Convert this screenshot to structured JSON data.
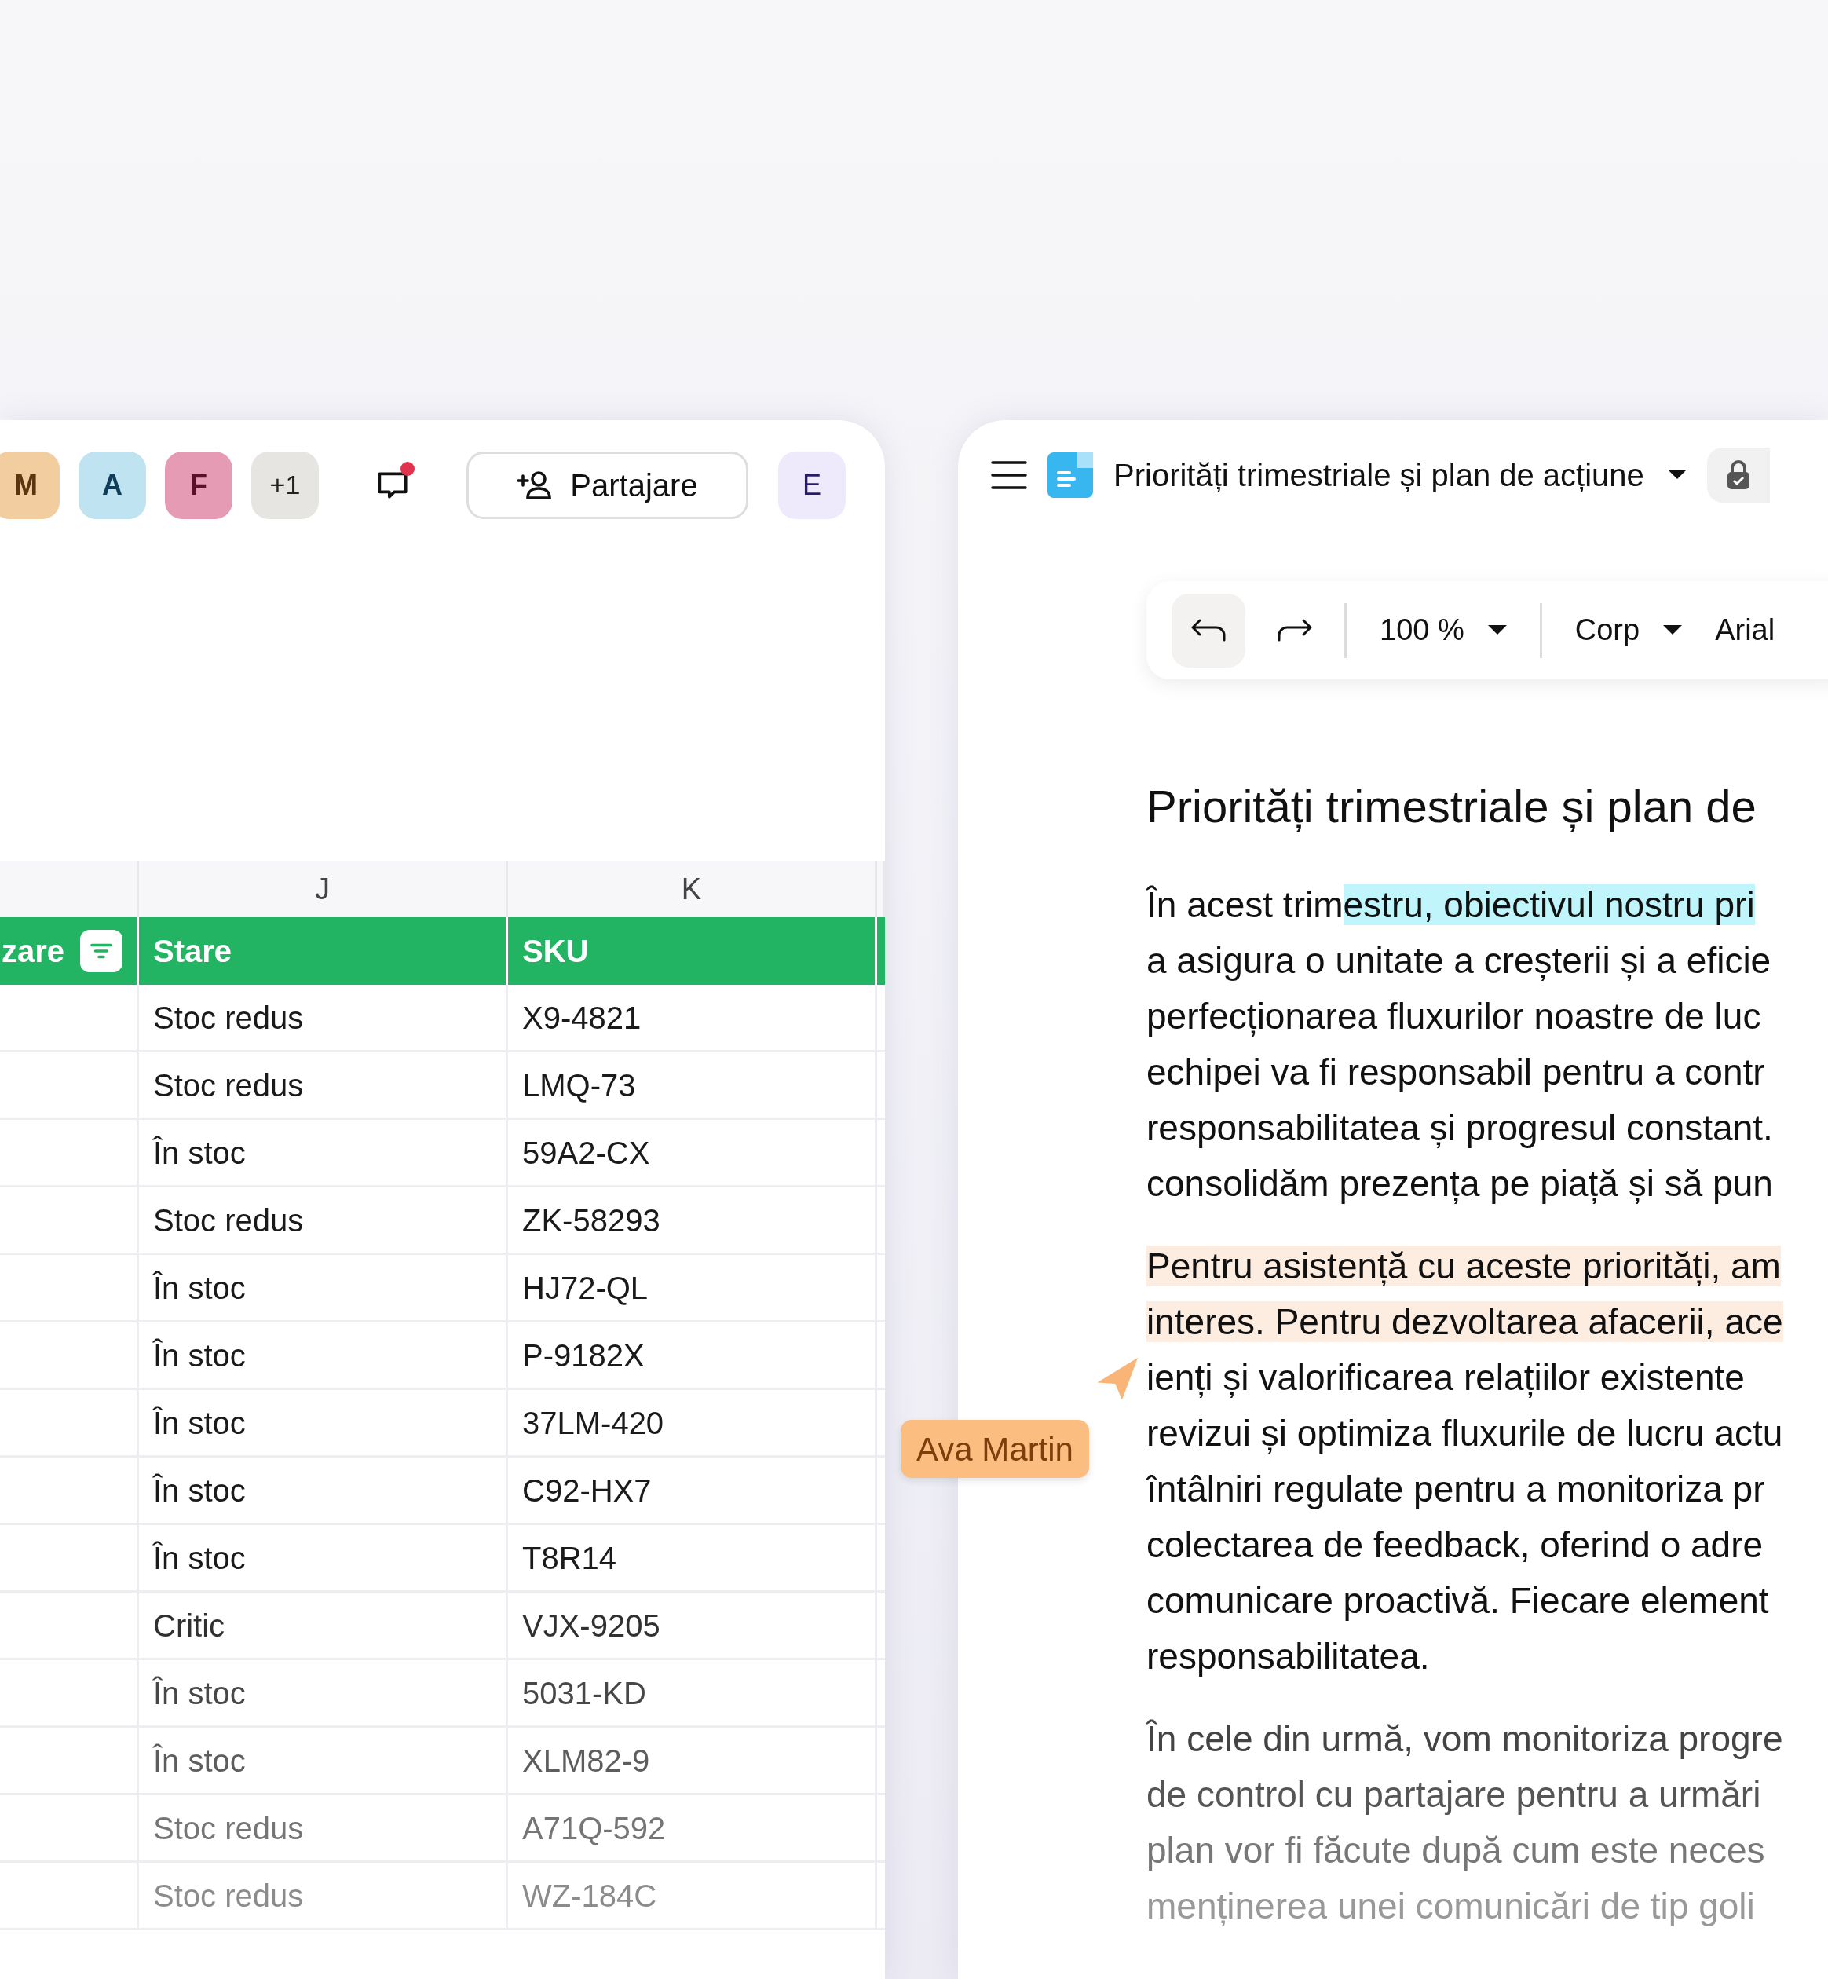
{
  "collaborators": [
    {
      "initial": "M",
      "color": "#f2cda0"
    },
    {
      "initial": "A",
      "color": "#bfe3f1"
    },
    {
      "initial": "F",
      "color": "#e59bb4"
    }
  ],
  "more_collaborators": "+1",
  "comments": {
    "unread": true
  },
  "share_button": "Partajare",
  "user_avatar": {
    "initial": "E"
  },
  "sheet": {
    "column_letters": [
      "J",
      "K"
    ],
    "columns": [
      {
        "label": "zare",
        "filter": true
      },
      {
        "label": "Stare"
      },
      {
        "label": "SKU"
      }
    ],
    "rows": [
      {
        "status": "Stoc redus",
        "sku": "X9-4821"
      },
      {
        "status": "Stoc redus",
        "sku": "LMQ-73"
      },
      {
        "status": "În stoc",
        "sku": "59A2-CX"
      },
      {
        "status": "Stoc redus",
        "sku": "ZK-58293"
      },
      {
        "status": "În stoc",
        "sku": "HJ72-QL"
      },
      {
        "status": "În stoc",
        "sku": "P-9182X"
      },
      {
        "status": "În stoc",
        "sku": "37LM-420"
      },
      {
        "status": "În stoc",
        "sku": "C92-HX7"
      },
      {
        "status": "În stoc",
        "sku": "T8R14"
      },
      {
        "status": "Critic",
        "sku": "VJX-9205"
      },
      {
        "status": "În stoc",
        "sku": "5031-KD"
      },
      {
        "status": "În stoc",
        "sku": "XLM82-9"
      },
      {
        "status": "Stoc redus",
        "sku": "A71Q-592"
      },
      {
        "status": "Stoc redus",
        "sku": "WZ-184C"
      }
    ]
  },
  "document": {
    "title": "Priorități trimestriale și plan de acțiune",
    "toolbar": {
      "zoom": "100 %",
      "style": "Corp",
      "font": "Arial"
    },
    "heading": "Priorități trimestriale și plan de",
    "paragraphs": [
      {
        "color": "#bff5fb",
        "lines": [
          {
            "text": "În acest trim",
            "highlighted": "estru, obiectivul nostru pri"
          },
          {
            "text": "a asigura o unitate a creșterii și a eficie"
          },
          {
            "text": "perfecționarea fluxurilor noastre de luc"
          },
          {
            "text": "echipei va fi responsabil pentru a contr"
          },
          {
            "text": "responsabilitatea și progresul constant."
          },
          {
            "text": "consolidăm prezența pe piață și să pun"
          }
        ]
      },
      {
        "color": "#fdece0",
        "lines": [
          {
            "highlighted": "Pentru asistență cu aceste priorități, am"
          },
          {
            "highlighted": "interes. Pentru dezvoltarea afacerii, ace"
          },
          {
            "text": "ienți și valorificarea relațiilor existente"
          },
          {
            "text": "revizui și optimiza fluxurile de lucru actu"
          },
          {
            "text": "întâlniri regulate pentru a monitoriza pr"
          },
          {
            "text": "colectarea de feedback, oferind o adre"
          },
          {
            "text": "comunicare proactivă. Fiecare element"
          },
          {
            "text": "responsabilitatea."
          }
        ]
      },
      {
        "lines": [
          {
            "text": "În cele din urmă, vom monitoriza progre"
          },
          {
            "text": "de control cu partajare pentru a urmări"
          },
          {
            "text": "plan vor fi făcute după cum este neces"
          },
          {
            "text": "menținerea unei comunicări de tip goli"
          }
        ]
      }
    ]
  },
  "cursor": {
    "name": "Ava Martin"
  }
}
